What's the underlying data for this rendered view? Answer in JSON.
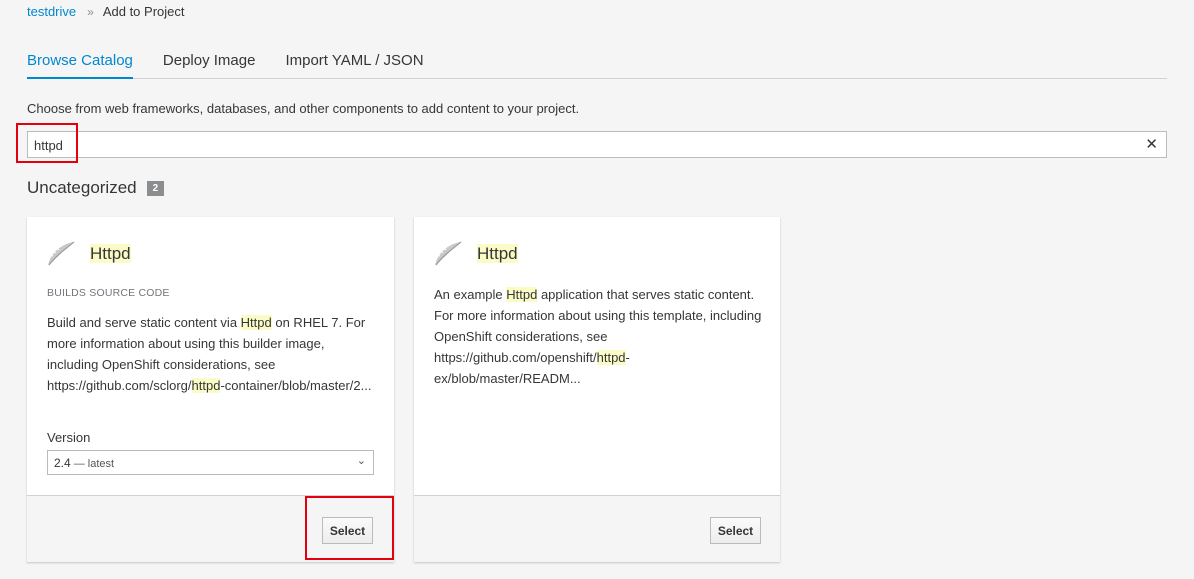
{
  "breadcrumb": {
    "project": "testdrive",
    "separator": "»",
    "current": "Add to Project"
  },
  "tabs": [
    "Browse Catalog",
    "Deploy Image",
    "Import YAML / JSON"
  ],
  "intro": "Choose from web frameworks, databases, and other components to add content to your project.",
  "search": {
    "value": "httpd",
    "clear_symbol": "✕"
  },
  "category": {
    "name": "Uncategorized",
    "count": "2"
  },
  "cards": [
    {
      "title": "Httpd",
      "subtitle": "BUILDS SOURCE CODE",
      "desc": {
        "pre": "Build and serve static content via ",
        "hl1": "Httpd",
        "mid": " on RHEL 7. For more information about using this builder image, including OpenShift considerations, see https://github.com/sclorg/",
        "hl2": "httpd",
        "post": "-container/blob/master/2..."
      },
      "version_label": "Version",
      "version_value": "2.4",
      "version_suffix": " — latest",
      "select_label": "Select"
    },
    {
      "title": "Httpd",
      "desc": {
        "pre": "An example ",
        "hl1": "Httpd",
        "mid": " application that serves static content. For more information about using this template, including OpenShift considerations, see https://github.com/openshift/",
        "hl2": "httpd",
        "post": "-ex/blob/master/READM..."
      },
      "select_label": "Select"
    }
  ],
  "colors": {
    "link": "#0088ce",
    "highlight": "#fbfbc8",
    "annotation": "#e5000f"
  }
}
